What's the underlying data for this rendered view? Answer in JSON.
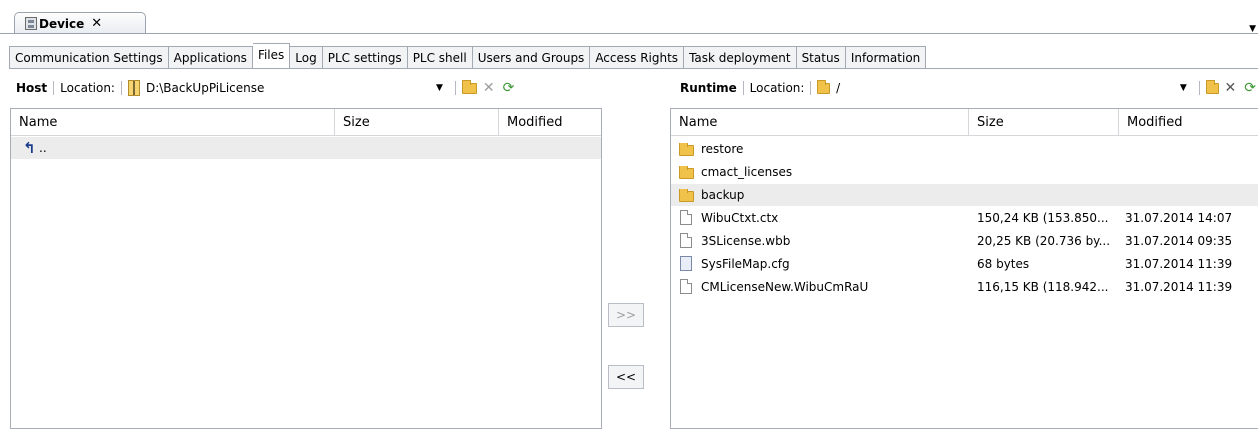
{
  "document_tab": {
    "title": "Device",
    "close": "✕"
  },
  "tabs": [
    "Communication Settings",
    "Applications",
    "Files",
    "Log",
    "PLC settings",
    "PLC shell",
    "Users and Groups",
    "Access Rights",
    "Task deployment",
    "Status",
    "Information"
  ],
  "active_tab": "Files",
  "host": {
    "label": "Host",
    "location_label": "Location:",
    "location_value": "D:\\BackUpPiLicense",
    "columns": {
      "name": "Name",
      "size": "Size",
      "modified": "Modified"
    },
    "rows": [
      {
        "name": "..",
        "icon": "up-arrow-icon"
      }
    ]
  },
  "runtime": {
    "label": "Runtime",
    "location_label": "Location:",
    "location_value": "/",
    "columns": {
      "name": "Name",
      "size": "Size",
      "modified": "Modified"
    },
    "rows": [
      {
        "name": "restore",
        "size": "",
        "modified": "",
        "icon": "folder-icon"
      },
      {
        "name": "cmact_licenses",
        "size": "",
        "modified": "",
        "icon": "folder-icon"
      },
      {
        "name": "backup",
        "size": "",
        "modified": "",
        "icon": "folder-icon"
      },
      {
        "name": "WibuCtxt.ctx",
        "size": "150,24 KB (153.850...",
        "modified": "31.07.2014 14:07",
        "icon": "file-icon"
      },
      {
        "name": "3SLicense.wbb",
        "size": "20,25 KB (20.736 by...",
        "modified": "31.07.2014 09:35",
        "icon": "file-icon"
      },
      {
        "name": "SysFileMap.cfg",
        "size": "68 bytes",
        "modified": "31.07.2014 11:39",
        "icon": "config-file-icon"
      },
      {
        "name": "CMLicenseNew.WibuCmRaU",
        "size": "116,15 KB (118.942...",
        "modified": "31.07.2014 11:39",
        "icon": "file-icon"
      }
    ]
  },
  "transfer": {
    "to_runtime": ">>",
    "to_host": "<<"
  },
  "colors": {
    "accent_green": "#3c9a35",
    "folder": "#f1c24a",
    "highlight_row": "#ececec"
  }
}
